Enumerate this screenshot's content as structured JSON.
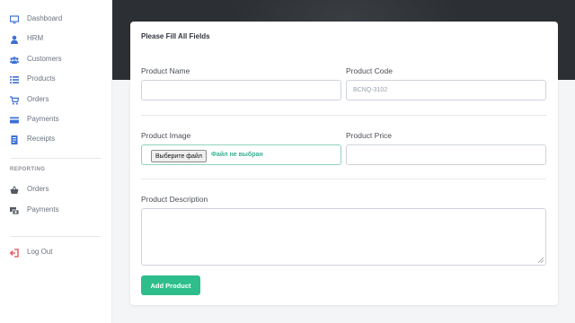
{
  "sidebar": {
    "items": [
      {
        "label": "Dashboard",
        "icon": "monitor-icon"
      },
      {
        "label": "HRM",
        "icon": "user-icon"
      },
      {
        "label": "Customers",
        "icon": "users-icon"
      },
      {
        "label": "Products",
        "icon": "list-icon"
      },
      {
        "label": "Orders",
        "icon": "cart-icon"
      },
      {
        "label": "Payments",
        "icon": "credit-card-icon"
      },
      {
        "label": "Receipts",
        "icon": "receipt-icon"
      }
    ],
    "reporting_title": "REPORTING",
    "reporting_items": [
      {
        "label": "Orders",
        "icon": "basket-icon"
      },
      {
        "label": "Payments",
        "icon": "money-icon"
      }
    ],
    "logout_label": "Log Out"
  },
  "form": {
    "title": "Please Fill All Fields",
    "product_name": {
      "label": "Product Name",
      "value": ""
    },
    "product_code": {
      "label": "Product Code",
      "value": "BCNQ-3102"
    },
    "product_image": {
      "label": "Product Image",
      "button": "Выберите файл",
      "status": "Файл не выбран"
    },
    "product_price": {
      "label": "Product Price",
      "value": ""
    },
    "product_description": {
      "label": "Product Description",
      "value": ""
    },
    "submit_label": "Add Product"
  },
  "colors": {
    "accent": "#2dbe8c",
    "icon": "#3d6fd6",
    "logout_icon": "#e5484d",
    "hero": "#2c2f33"
  }
}
